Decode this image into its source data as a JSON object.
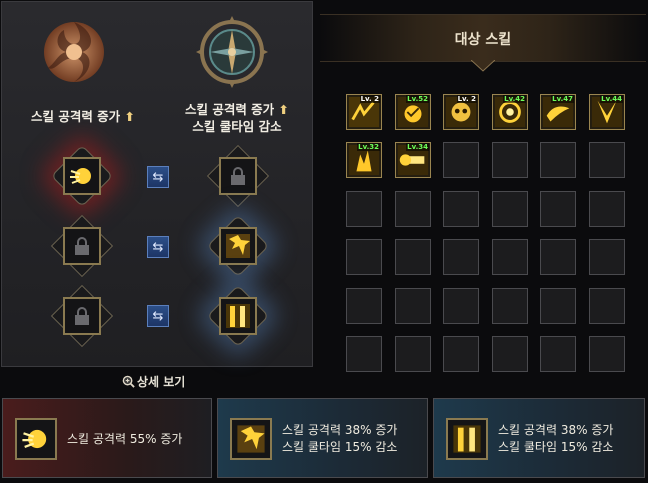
{
  "left": {
    "col_a_title": "스킬 공격력 증가",
    "col_b_title_1": "스킬 공격력 증가",
    "col_b_title_2": "스킬 쿨타임 감소",
    "arrow_glyph": "⬆",
    "detail_link": "상세 보기",
    "rows": [
      {
        "a": "sun-skill-icon",
        "b": "lock-icon",
        "a_glow": "red",
        "b_glow": "none"
      },
      {
        "a": "lock-icon",
        "b": "burst-skill-icon",
        "a_glow": "none",
        "b_glow": "blue"
      },
      {
        "a": "lock-icon",
        "b": "pillar-skill-icon",
        "a_glow": "none",
        "b_glow": "blue"
      }
    ],
    "swap_glyph": "⇆"
  },
  "right": {
    "title": "대상 스킬",
    "skills": [
      {
        "level": "Lv. 2",
        "icon": "dash-skill-icon"
      },
      {
        "level": "Lv.52",
        "icon": "shield-skill-icon"
      },
      {
        "level": "Lv. 2",
        "icon": "skull-skill-icon"
      },
      {
        "level": "Lv.42",
        "icon": "orb-skill-icon"
      },
      {
        "level": "Lv.47",
        "icon": "wave-skill-icon"
      },
      {
        "level": "Lv.44",
        "icon": "spike-skill-icon"
      },
      {
        "level": "Lv.32",
        "icon": "flame-skill-icon"
      },
      {
        "level": "Lv.34",
        "icon": "beam-skill-icon"
      }
    ],
    "grid_cols": 6,
    "grid_rows": 6
  },
  "cards": [
    {
      "line1": "스킬 공격력 55% 증가",
      "line2": "",
      "icon": "sun-skill-icon"
    },
    {
      "line1": "스킬 공격력 38% 증가",
      "line2": "스킬 쿨타임 15% 감소",
      "icon": "burst-skill-icon"
    },
    {
      "line1": "스킬 공격력 38% 증가",
      "line2": "스킬 쿨타임 15% 감소",
      "icon": "pillar-skill-icon"
    }
  ],
  "colors": {
    "accent_gold": "#c8a24a",
    "level_green": "#6dff5a",
    "swap_blue": "#2c4f88"
  }
}
